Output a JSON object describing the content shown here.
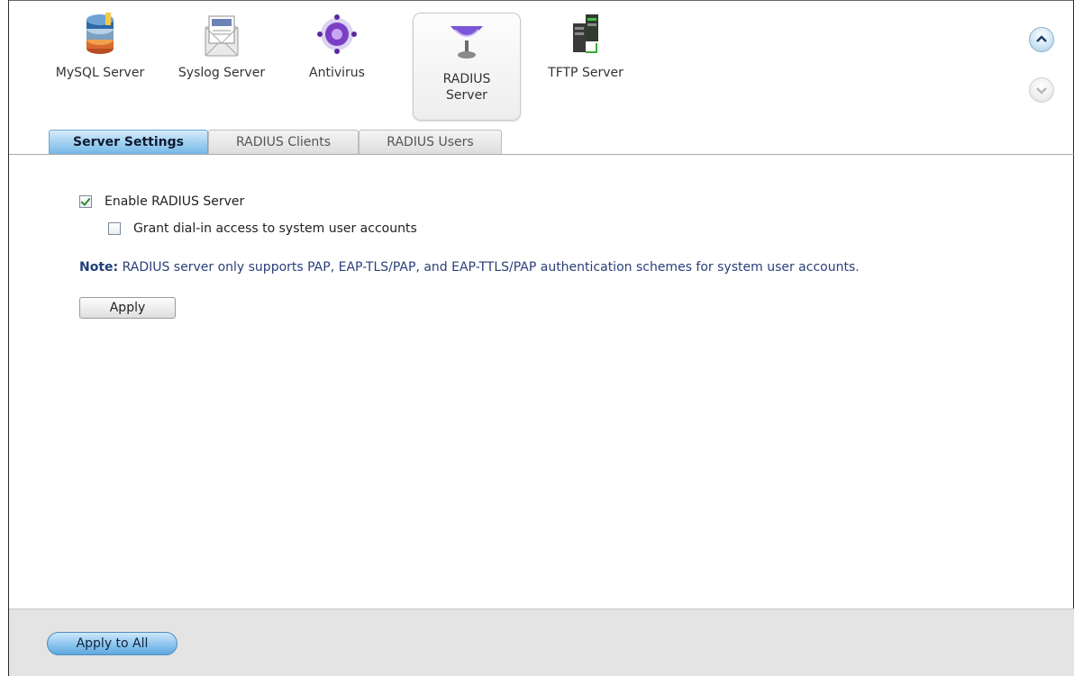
{
  "apps": [
    {
      "label": "MySQL Server",
      "icon": "mysql-database-icon"
    },
    {
      "label": "Syslog Server",
      "icon": "syslog-envelope-icon"
    },
    {
      "label": "Antivirus",
      "icon": "antivirus-icon"
    },
    {
      "label_line1": "RADIUS",
      "label_line2": "Server",
      "icon": "radius-antenna-icon",
      "selected": true
    },
    {
      "label": "TFTP Server",
      "icon": "tftp-server-icon"
    }
  ],
  "nav": {
    "up_icon": "chevron-up-icon",
    "down_icon": "chevron-down-icon"
  },
  "tabs": [
    {
      "label": "Server Settings",
      "active": true
    },
    {
      "label": "RADIUS Clients",
      "active": false
    },
    {
      "label": "RADIUS Users",
      "active": false
    }
  ],
  "settings": {
    "enable_label": "Enable RADIUS Server",
    "enable_checked": true,
    "grant_label": "Grant dial-in access to system user accounts",
    "grant_checked": false,
    "note_prefix": "Note:",
    "note_text": " RADIUS server only supports PAP, EAP-TLS/PAP, and EAP-TTLS/PAP authentication schemes for system user accounts.",
    "apply_label": "Apply"
  },
  "footer": {
    "apply_all_label": "Apply to All"
  },
  "colors": {
    "accent_blue": "#8cc4ee",
    "note_text": "#2a3f78"
  }
}
